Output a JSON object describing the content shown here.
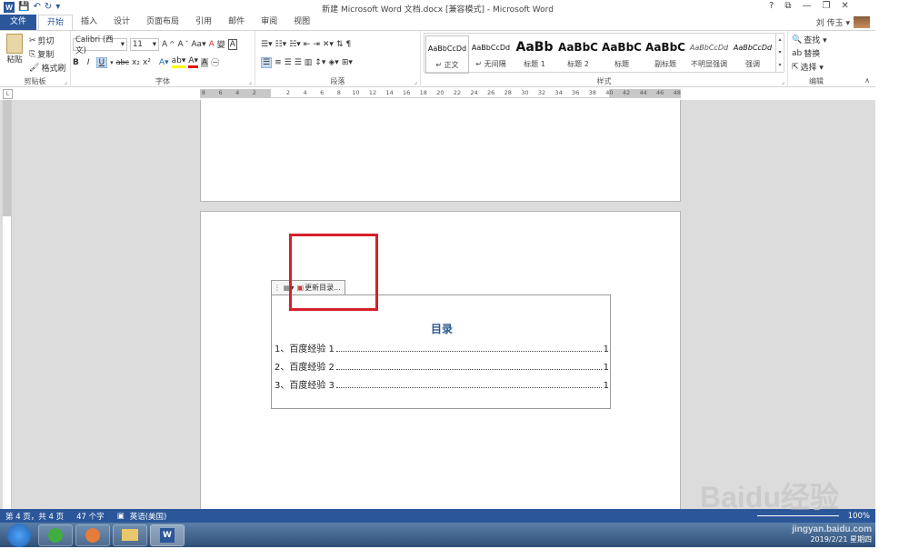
{
  "window": {
    "title": "新建 Microsoft Word 文档.docx [兼容模式] - Microsoft Word",
    "help": "?",
    "controls": [
      "⧉",
      "—",
      "❐",
      "✕"
    ]
  },
  "user": {
    "name": "刘 传玉 ▾"
  },
  "tabs": [
    "文件",
    "开始",
    "插入",
    "设计",
    "页面布局",
    "引用",
    "邮件",
    "审阅",
    "视图"
  ],
  "ribbon": {
    "clipboard": {
      "label": "剪贴板",
      "paste": "粘贴",
      "cut": "剪切",
      "copy": "复制",
      "format_painter": "格式刷"
    },
    "font": {
      "label": "字体",
      "name": "Calibri (西文)",
      "size": "11",
      "bold": "B",
      "italic": "I",
      "underline": "U",
      "strike": "abc",
      "sub": "x₂",
      "sup": "x²"
    },
    "paragraph": {
      "label": "段落"
    },
    "styles": {
      "label": "样式",
      "items": [
        {
          "preview": "AaBbCcDd",
          "name": "↵ 正文"
        },
        {
          "preview": "AaBbCcDd",
          "name": "↵ 无间隔"
        },
        {
          "preview": "AaBb",
          "name": "标题 1"
        },
        {
          "preview": "AaBbC",
          "name": "标题 2"
        },
        {
          "preview": "AaBbC",
          "name": "标题"
        },
        {
          "preview": "AaBbC",
          "name": "副标题"
        },
        {
          "preview": "AaBbCcDd",
          "name": "不明显强调"
        },
        {
          "preview": "AaBbCcDd",
          "name": "强调"
        }
      ]
    },
    "editing": {
      "label": "编辑",
      "find": "查找 ▾",
      "replace": "替换",
      "select": "选择 ▾"
    }
  },
  "ruler": {
    "numbers": [
      "8",
      "6",
      "4",
      "2",
      "",
      "2",
      "4",
      "6",
      "8",
      "10",
      "12",
      "14",
      "16",
      "18",
      "20",
      "22",
      "24",
      "26",
      "28",
      "30",
      "32",
      "34",
      "36",
      "38",
      "40",
      "42",
      "44",
      "46",
      "48"
    ]
  },
  "toc": {
    "update_button": "更新目录...",
    "title": "目录",
    "entries": [
      {
        "text": "1、百度经验 1",
        "page": "1"
      },
      {
        "text": "2、百度经验 2",
        "page": "1"
      },
      {
        "text": "3、百度经验 3",
        "page": "1"
      }
    ]
  },
  "status": {
    "page": "第 4 页，共 4 页",
    "words": "47 个字",
    "language": "英语(美国)",
    "zoom": "100%"
  },
  "taskbar": {
    "date": "2019/2/21 星期四"
  },
  "watermark": {
    "brand": "Baidu经验",
    "url": "jingyan.baidu.com"
  },
  "colors": {
    "accent": "#2b579a",
    "highlight": "#d6202a",
    "toc_title": "#2e5a8f"
  }
}
